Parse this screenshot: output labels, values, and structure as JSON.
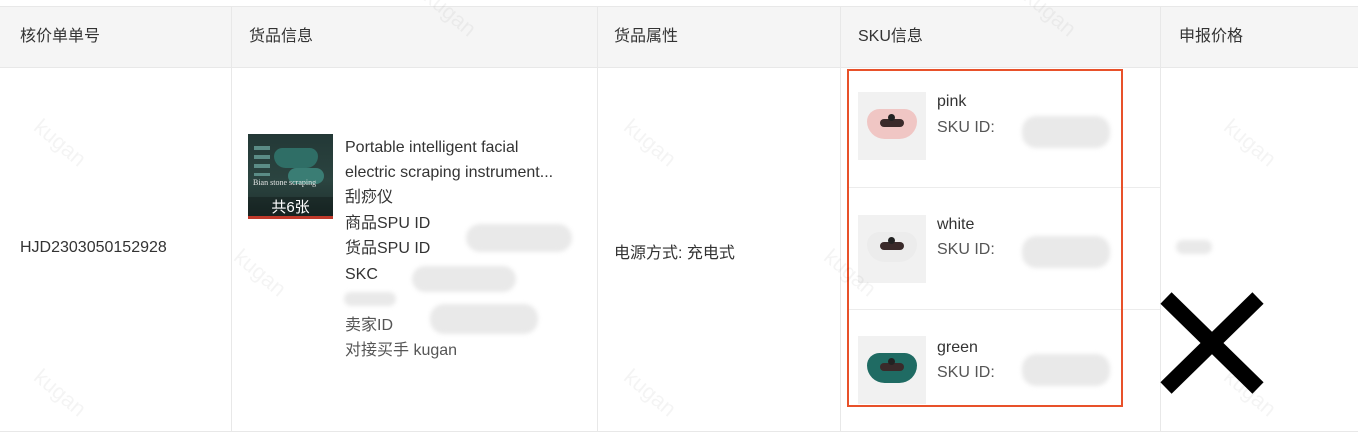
{
  "table": {
    "headers": [
      "核价单单号",
      "货品信息",
      "货品属性",
      "SKU信息",
      "申报价格"
    ],
    "row": {
      "order_no": "HJD2303050152928",
      "product": {
        "image_count_label": "共6张",
        "thumb_text": "Bian stone scraping",
        "title_line1": "Portable intelligent facial",
        "title_line2": "electric scraping instrument...",
        "name_cn": "刮痧仪",
        "spu_label": "商品SPU ID",
        "goods_spu_label": "货品SPU ID",
        "skc_label": "SKC",
        "seller_label": "卖家ID",
        "buyer_label": "对接买手 kugan"
      },
      "attribute": "电源方式: 充电式",
      "skus": [
        {
          "name": "pink",
          "id_label": "SKU ID:",
          "color": "#f0c6c4"
        },
        {
          "name": "white",
          "id_label": "SKU ID:",
          "color": "#ececec"
        },
        {
          "name": "green",
          "id_label": "SKU ID:",
          "color": "#1f6b63"
        }
      ]
    }
  },
  "watermark": "kugan",
  "colors": {
    "highlight_border": "#e8512a",
    "header_bg": "#f5f5f5"
  }
}
